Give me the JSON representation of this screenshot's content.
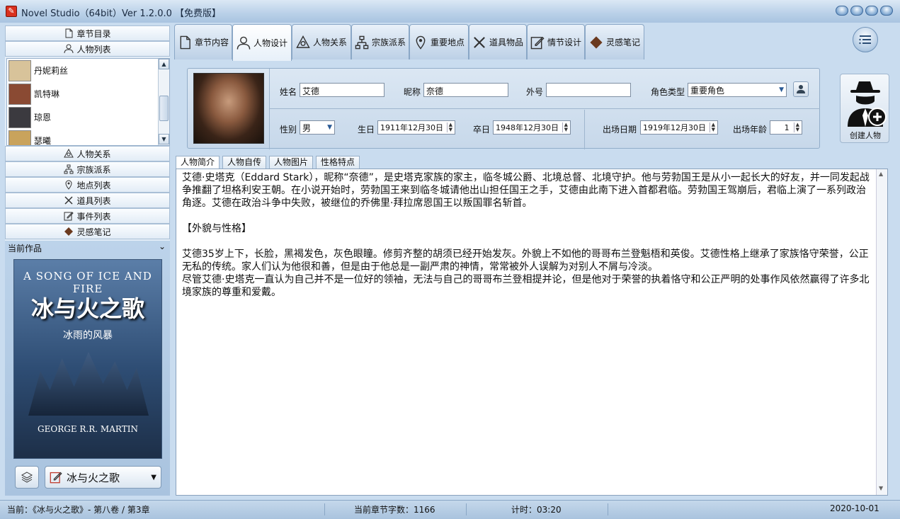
{
  "window": {
    "title": "Novel Studio（64bit）Ver 1.2.0.0 【免费版】",
    "app_icon_glyph": "✎"
  },
  "sidebar": {
    "nav_top": [
      {
        "label": "章节目录",
        "icon": "document-icon"
      },
      {
        "label": "人物列表",
        "icon": "person-icon"
      }
    ],
    "characters": [
      {
        "name": "丹妮莉丝",
        "avatar_color": "#d8c39a"
      },
      {
        "name": "凯特琳",
        "avatar_color": "#8a4a33"
      },
      {
        "name": "琼恩",
        "avatar_color": "#3b3a3f"
      },
      {
        "name": "瑟曦",
        "avatar_color": "#c9a35c"
      }
    ],
    "nav_bottom": [
      {
        "label": "人物关系",
        "icon": "relation-icon"
      },
      {
        "label": "宗族派系",
        "icon": "hierarchy-icon"
      },
      {
        "label": "地点列表",
        "icon": "location-pin-icon"
      },
      {
        "label": "道具列表",
        "icon": "crossed-swords-icon"
      },
      {
        "label": "事件列表",
        "icon": "edit-note-icon"
      },
      {
        "label": "灵感笔记",
        "icon": "diamond-icon"
      }
    ],
    "work_panel": {
      "header": "当前作品",
      "cover": {
        "line1": "A SONG OF ICE AND FIRE",
        "title": "冰与火之歌",
        "subtitle": "冰雨的风暴",
        "author": "GEORGE R.R. MARTIN"
      },
      "selected_work": "冰与火之歌"
    }
  },
  "tabs": [
    {
      "label": "章节内容",
      "icon": "document-icon"
    },
    {
      "label": "人物设计",
      "icon": "person-icon",
      "active": true
    },
    {
      "label": "人物关系",
      "icon": "relation-icon"
    },
    {
      "label": "宗族派系",
      "icon": "hierarchy-icon"
    },
    {
      "label": "重要地点",
      "icon": "location-pin-icon"
    },
    {
      "label": "道具物品",
      "icon": "crossed-swords-icon"
    },
    {
      "label": "情节设计",
      "icon": "edit-note-icon"
    },
    {
      "label": "灵感笔记",
      "icon": "diamond-icon"
    }
  ],
  "form": {
    "name": {
      "label": "姓名",
      "value": "艾德"
    },
    "nickname": {
      "label": "昵称",
      "value": "奈德"
    },
    "alias": {
      "label": "外号",
      "value": ""
    },
    "role_type": {
      "label": "角色类型",
      "value": "重要角色"
    },
    "gender": {
      "label": "性别",
      "value": "男"
    },
    "birth": {
      "label": "生日",
      "value": "1911年12月30日"
    },
    "death": {
      "label": "卒日",
      "value": "1948年12月30日"
    },
    "appear_date": {
      "label": "出场日期",
      "value": "1919年12月30日"
    },
    "appear_age": {
      "label": "出场年龄",
      "value": "1"
    }
  },
  "create_button": {
    "label": "创建人物"
  },
  "subtabs": [
    "人物简介",
    "人物自传",
    "人物图片",
    "性格特点"
  ],
  "content": {
    "para1": "艾德·史塔克（Eddard Stark），昵称“奈德”，是史塔克家族的家主，临冬城公爵、北境总督、北境守护。他与劳勃国王是从小一起长大的好友，并一同发起战争推翻了坦格利安王朝。在小说开始时，劳勃国王来到临冬城请他出山担任国王之手，艾德由此南下进入首都君临。劳勃国王驾崩后，君临上演了一系列政治角逐。艾德在政治斗争中失败，被继位的乔佛里·拜拉席恩国王以叛国罪名斩首。",
    "heading": "【外貌与性格】",
    "para2": "艾德35岁上下，长脸，黑褐发色，灰色眼瞳。修剪齐整的胡须已经开始发灰。外貌上不如他的哥哥布兰登魁梧和英俊。艾德性格上继承了家族恪守荣誉，公正无私的传统。家人们认为他很和善，但是由于他总是一副严肃的神情，常常被外人误解为对别人不屑与冷淡。",
    "para3": "尽管艾德·史塔克一直认为自己并不是一位好的领袖，无法与自己的哥哥布兰登相提并论，但是他对于荣誉的执着恪守和公正严明的处事作风依然赢得了许多北境家族的尊重和爱戴。"
  },
  "status": {
    "current": "当前：《冰与火之歌》- 第八卷 / 第3章",
    "word_count": "当前章节字数：1166",
    "timer": "计时：03:20",
    "date": "2020-10-01"
  }
}
